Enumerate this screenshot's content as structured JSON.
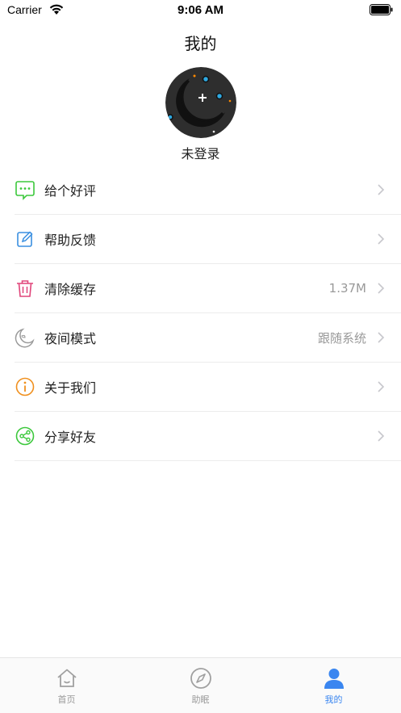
{
  "status_bar": {
    "carrier": "Carrier",
    "time": "9:06 AM"
  },
  "header": {
    "title": "我的"
  },
  "profile": {
    "login_status": "未登录"
  },
  "menu": [
    {
      "label": "给个好评",
      "value": "",
      "icon": "chat-bubble-icon",
      "color": "#3cc83c"
    },
    {
      "label": "帮助反馈",
      "value": "",
      "icon": "edit-icon",
      "color": "#3a8fe0"
    },
    {
      "label": "清除缓存",
      "value": "1.37M",
      "icon": "trash-icon",
      "color": "#e0457a"
    },
    {
      "label": "夜间模式",
      "value": "跟随系统",
      "icon": "moon-icon",
      "color": "#9a9a9a"
    },
    {
      "label": "关于我们",
      "value": "",
      "icon": "info-icon",
      "color": "#f0901e"
    },
    {
      "label": "分享好友",
      "value": "",
      "icon": "share-icon",
      "color": "#3cc83c"
    }
  ],
  "tab_bar": {
    "tabs": [
      {
        "label": "首页",
        "icon": "home-icon",
        "active": false
      },
      {
        "label": "助眠",
        "icon": "compass-icon",
        "active": false
      },
      {
        "label": "我的",
        "icon": "user-icon",
        "active": true
      }
    ],
    "active_color": "#3a86f0",
    "inactive_color": "#999999"
  }
}
